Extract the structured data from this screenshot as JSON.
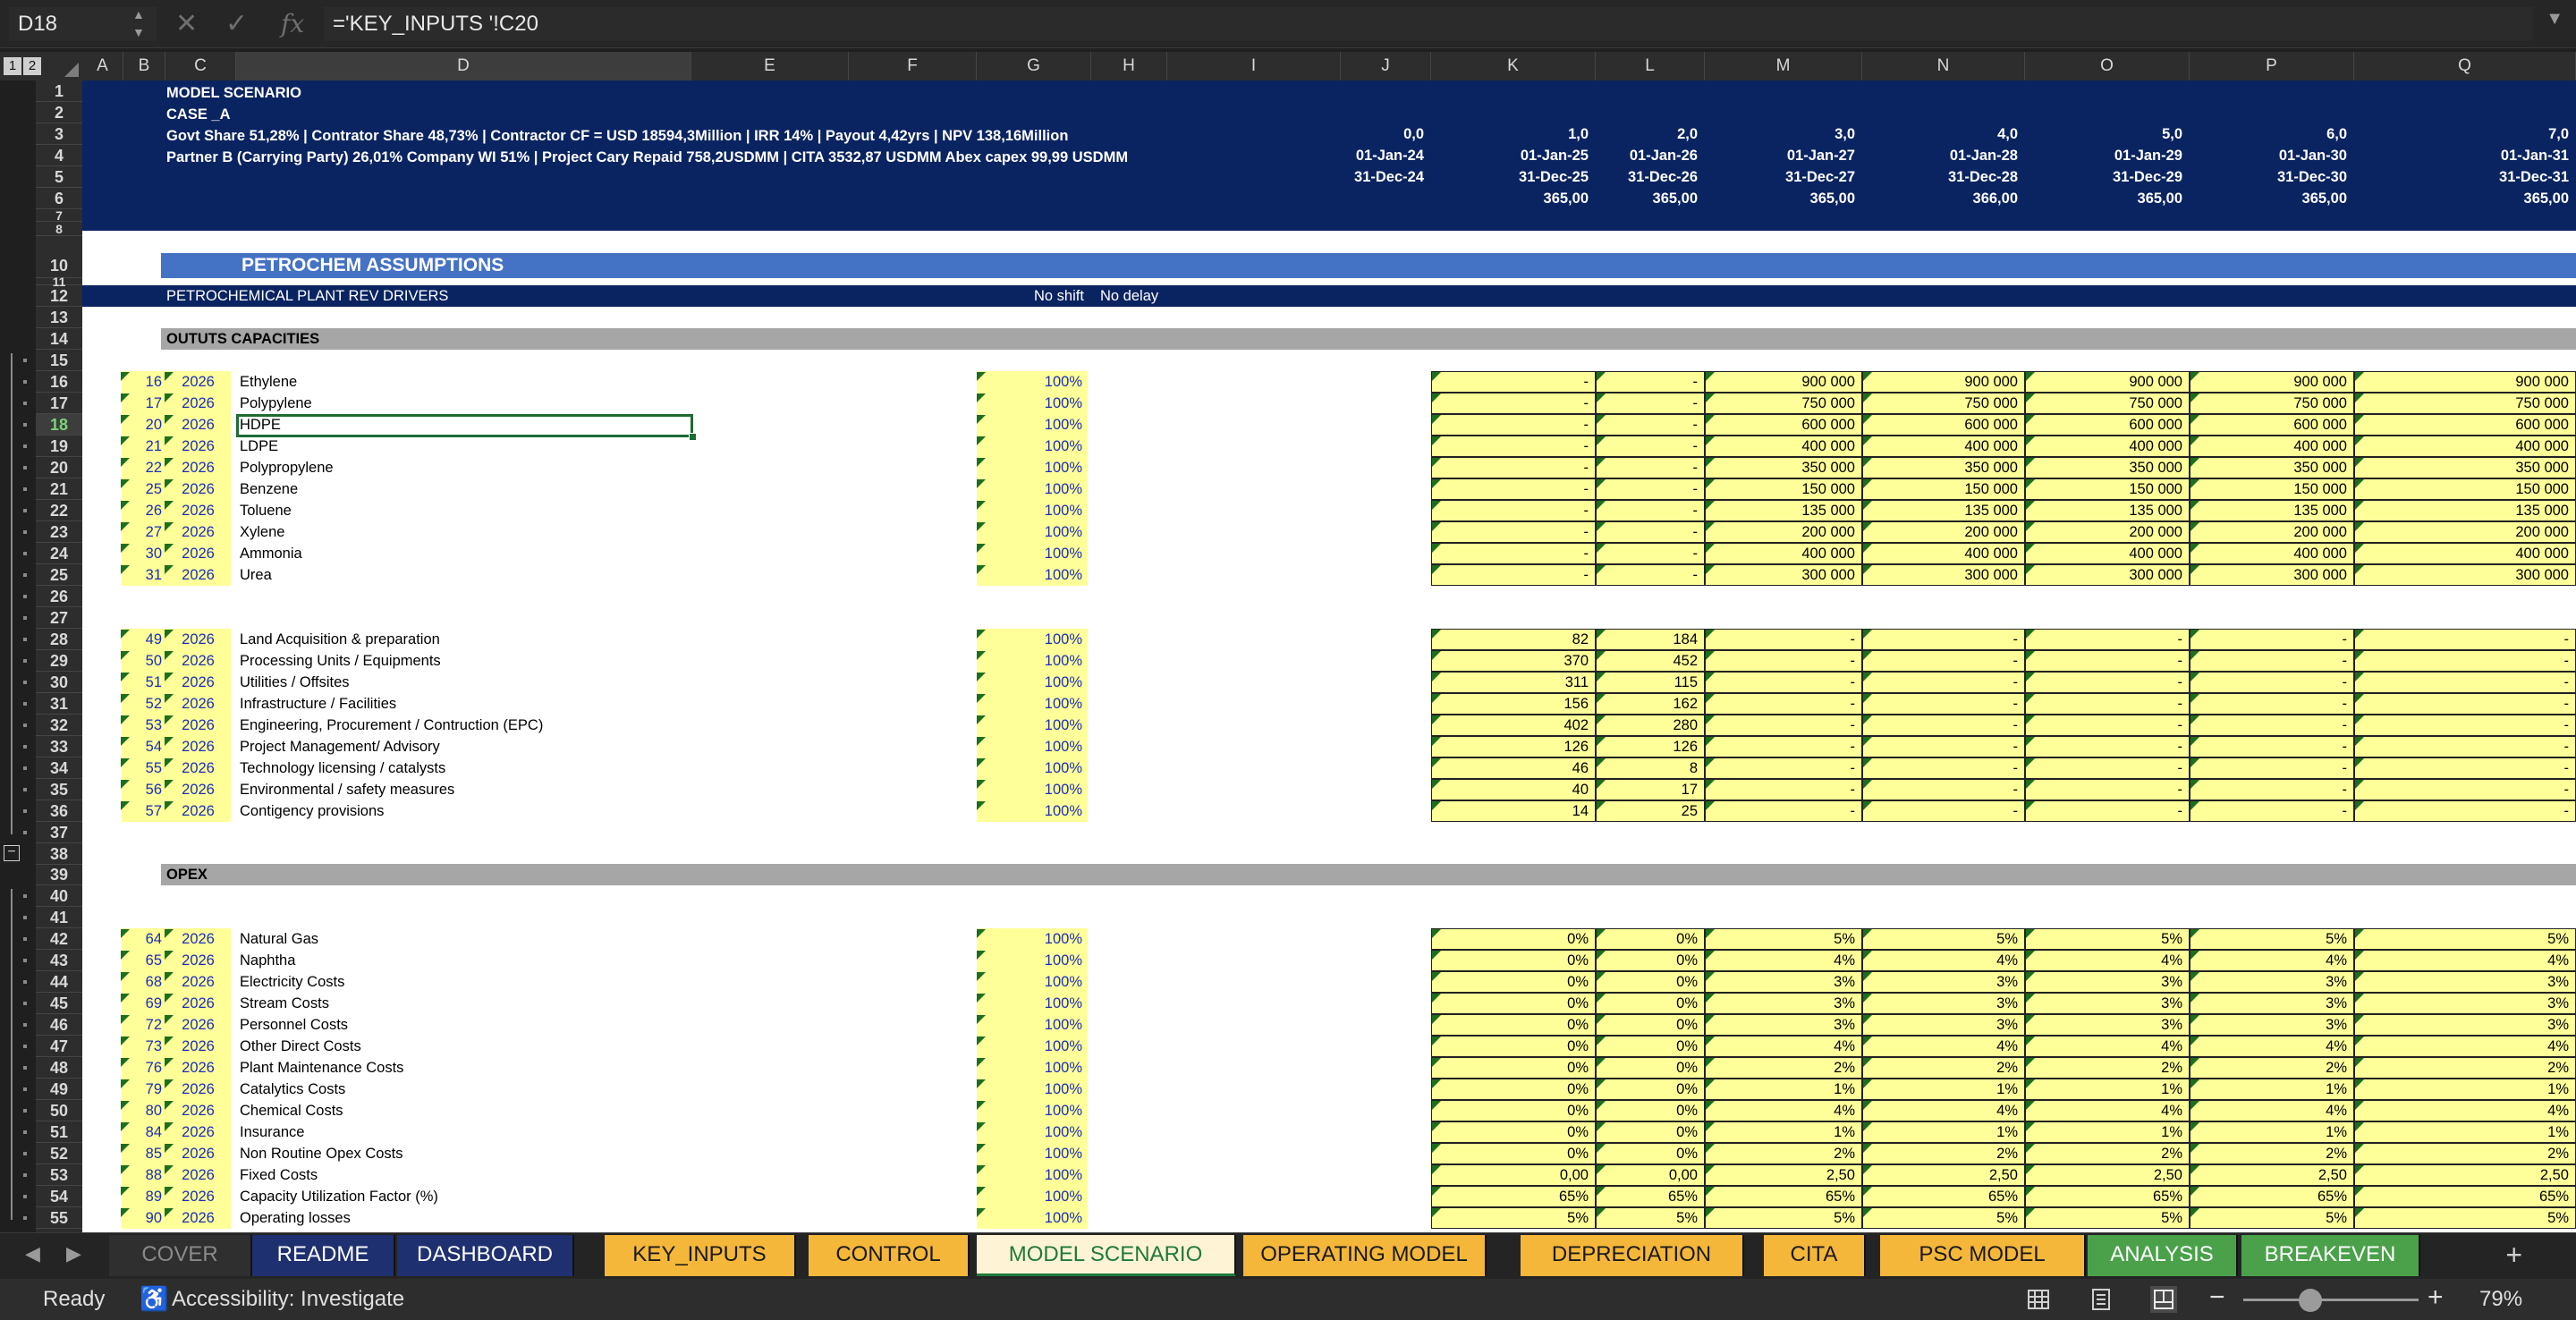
{
  "formula_bar": {
    "name_box": "D18",
    "formula": "='KEY_INPUTS '!C20",
    "fx": "fx"
  },
  "outline_levels": [
    "1",
    "2"
  ],
  "columns": [
    "A",
    "B",
    "C",
    "D",
    "E",
    "F",
    "G",
    "H",
    "I",
    "J",
    "K",
    "L",
    "M",
    "N",
    "O",
    "P",
    "Q"
  ],
  "selected_column": "D",
  "selected_row": "18",
  "header": {
    "model_scenario": "MODEL SCENARIO",
    "case": "CASE _A",
    "line3": "Govt Share 51,28% | Contrator Share 48,73% |  Contractor CF = USD 18594,3Million | IRR 14% | Payout 4,42yrs | NPV 138,16Million",
    "line4": "Partner B (Carrying Party) 26,01% Company WI 51% |  Project Cary Repaid  758,2USDMM  |  CITA 3532,87  USDMM Abex capex 99,99  USDMM",
    "periods": [
      {
        "col": "J",
        "year": "0,0",
        "start": "01-Jan-24",
        "end": "31-Dec-24",
        "days": ""
      },
      {
        "col": "K",
        "year": "1,0",
        "start": "01-Jan-25",
        "end": "31-Dec-25",
        "days": "365,00"
      },
      {
        "col": "L",
        "year": "2,0",
        "start": "01-Jan-26",
        "end": "31-Dec-26",
        "days": "365,00"
      },
      {
        "col": "M",
        "year": "3,0",
        "start": "01-Jan-27",
        "end": "31-Dec-27",
        "days": "365,00"
      },
      {
        "col": "N",
        "year": "4,0",
        "start": "01-Jan-28",
        "end": "31-Dec-28",
        "days": "366,00"
      },
      {
        "col": "O",
        "year": "5,0",
        "start": "01-Jan-29",
        "end": "31-Dec-29",
        "days": "365,00"
      },
      {
        "col": "P",
        "year": "6,0",
        "start": "01-Jan-30",
        "end": "31-Dec-30",
        "days": "365,00"
      },
      {
        "col": "Q",
        "year": "7,0",
        "start": "01-Jan-31",
        "end": "31-Dec-31",
        "days": "365,00"
      }
    ]
  },
  "row_numbers": [
    "1",
    "2",
    "3",
    "4",
    "5",
    "6",
    "7",
    "8",
    "10",
    "11",
    "12",
    "13",
    "14",
    "15",
    "16",
    "17",
    "18",
    "19",
    "20",
    "21",
    "22",
    "23",
    "24",
    "25",
    "26",
    "27",
    "28",
    "29",
    "30",
    "31",
    "32",
    "33",
    "34",
    "35",
    "36",
    "37",
    "38",
    "39",
    "40",
    "41",
    "42",
    "43",
    "44",
    "45",
    "46",
    "47",
    "48",
    "49",
    "50",
    "51",
    "52",
    "53",
    "54",
    "55"
  ],
  "petrochem_title": "PETROCHEM ASSUMPTIONS",
  "rev_drivers": {
    "label": "PETROCHEMICAL PLANT REV DRIVERS",
    "shift": "No shift",
    "delay": "No delay"
  },
  "sections": {
    "outputs": "OUTUTS CAPACITIES",
    "opex": "OPEX"
  },
  "output_rows": [
    {
      "row": "16",
      "ref": "16",
      "year": "2026",
      "name": "Ethylene",
      "pct": "100%",
      "vals": [
        "-",
        "-",
        "900 000",
        "900 000",
        "900 000",
        "900 000",
        "900 000"
      ]
    },
    {
      "row": "17",
      "ref": "17",
      "year": "2026",
      "name": "Polypylene",
      "pct": "100%",
      "vals": [
        "-",
        "-",
        "750 000",
        "750 000",
        "750 000",
        "750 000",
        "750 000"
      ]
    },
    {
      "row": "18",
      "ref": "20",
      "year": "2026",
      "name": "HDPE",
      "pct": "100%",
      "vals": [
        "-",
        "-",
        "600 000",
        "600 000",
        "600 000",
        "600 000",
        "600 000"
      ]
    },
    {
      "row": "19",
      "ref": "21",
      "year": "2026",
      "name": "LDPE",
      "pct": "100%",
      "vals": [
        "-",
        "-",
        "400 000",
        "400 000",
        "400 000",
        "400 000",
        "400 000"
      ]
    },
    {
      "row": "20",
      "ref": "22",
      "year": "2026",
      "name": "Polypropylene",
      "pct": "100%",
      "vals": [
        "-",
        "-",
        "350 000",
        "350 000",
        "350 000",
        "350 000",
        "350 000"
      ]
    },
    {
      "row": "21",
      "ref": "25",
      "year": "2026",
      "name": "Benzene",
      "pct": "100%",
      "vals": [
        "-",
        "-",
        "150 000",
        "150 000",
        "150 000",
        "150 000",
        "150 000"
      ]
    },
    {
      "row": "22",
      "ref": "26",
      "year": "2026",
      "name": "Toluene",
      "pct": "100%",
      "vals": [
        "-",
        "-",
        "135 000",
        "135 000",
        "135 000",
        "135 000",
        "135 000"
      ]
    },
    {
      "row": "23",
      "ref": "27",
      "year": "2026",
      "name": "Xylene",
      "pct": "100%",
      "vals": [
        "-",
        "-",
        "200 000",
        "200 000",
        "200 000",
        "200 000",
        "200 000"
      ]
    },
    {
      "row": "24",
      "ref": "30",
      "year": "2026",
      "name": "Ammonia",
      "pct": "100%",
      "vals": [
        "-",
        "-",
        "400 000",
        "400 000",
        "400 000",
        "400 000",
        "400 000"
      ]
    },
    {
      "row": "25",
      "ref": "31",
      "year": "2026",
      "name": "Urea",
      "pct": "100%",
      "vals": [
        "-",
        "-",
        "300 000",
        "300 000",
        "300 000",
        "300 000",
        "300 000"
      ]
    }
  ],
  "capex_rows": [
    {
      "row": "28",
      "ref": "49",
      "year": "2026",
      "name": "Land Acquisition & preparation",
      "pct": "100%",
      "vals": [
        "82",
        "184",
        "-",
        "-",
        "-",
        "-",
        "-"
      ]
    },
    {
      "row": "29",
      "ref": "50",
      "year": "2026",
      "name": "Processing Units /  Equipments",
      "pct": "100%",
      "vals": [
        "370",
        "452",
        "-",
        "-",
        "-",
        "-",
        "-"
      ]
    },
    {
      "row": "30",
      "ref": "51",
      "year": "2026",
      "name": "Utilities  /  Offsites",
      "pct": "100%",
      "vals": [
        "311",
        "115",
        "-",
        "-",
        "-",
        "-",
        "-"
      ]
    },
    {
      "row": "31",
      "ref": "52",
      "year": "2026",
      "name": "Infrastructure /  Facilities",
      "pct": "100%",
      "vals": [
        "156",
        "162",
        "-",
        "-",
        "-",
        "-",
        "-"
      ]
    },
    {
      "row": "32",
      "ref": "53",
      "year": "2026",
      "name": "Engineering, Procurement / Contruction (EPC)",
      "pct": "100%",
      "vals": [
        "402",
        "280",
        "-",
        "-",
        "-",
        "-",
        "-"
      ]
    },
    {
      "row": "33",
      "ref": "54",
      "year": "2026",
      "name": "Project Management/ Advisory",
      "pct": "100%",
      "vals": [
        "126",
        "126",
        "-",
        "-",
        "-",
        "-",
        "-"
      ]
    },
    {
      "row": "34",
      "ref": "55",
      "year": "2026",
      "name": "Technology licensing  / catalysts",
      "pct": "100%",
      "vals": [
        "46",
        "8",
        "-",
        "-",
        "-",
        "-",
        "-"
      ]
    },
    {
      "row": "35",
      "ref": "56",
      "year": "2026",
      "name": "Environmental / safety measures",
      "pct": "100%",
      "vals": [
        "40",
        "17",
        "-",
        "-",
        "-",
        "-",
        "-"
      ]
    },
    {
      "row": "36",
      "ref": "57",
      "year": "2026",
      "name": "Contigency provisions",
      "pct": "100%",
      "vals": [
        "14",
        "25",
        "-",
        "-",
        "-",
        "-",
        "-"
      ]
    }
  ],
  "opex_rows": [
    {
      "row": "42",
      "ref": "64",
      "year": "2026",
      "name": "Natural Gas",
      "pct": "100%",
      "vals": [
        "0%",
        "0%",
        "5%",
        "5%",
        "5%",
        "5%",
        "5%"
      ]
    },
    {
      "row": "43",
      "ref": "65",
      "year": "2026",
      "name": "Naphtha",
      "pct": "100%",
      "vals": [
        "0%",
        "0%",
        "4%",
        "4%",
        "4%",
        "4%",
        "4%"
      ]
    },
    {
      "row": "44",
      "ref": "68",
      "year": "2026",
      "name": "Electricity Costs",
      "pct": "100%",
      "vals": [
        "0%",
        "0%",
        "3%",
        "3%",
        "3%",
        "3%",
        "3%"
      ]
    },
    {
      "row": "45",
      "ref": "69",
      "year": "2026",
      "name": "Stream Costs",
      "pct": "100%",
      "vals": [
        "0%",
        "0%",
        "3%",
        "3%",
        "3%",
        "3%",
        "3%"
      ]
    },
    {
      "row": "46",
      "ref": "72",
      "year": "2026",
      "name": "Personnel Costs",
      "pct": "100%",
      "vals": [
        "0%",
        "0%",
        "3%",
        "3%",
        "3%",
        "3%",
        "3%"
      ]
    },
    {
      "row": "47",
      "ref": "73",
      "year": "2026",
      "name": "Other Direct Costs",
      "pct": "100%",
      "vals": [
        "0%",
        "0%",
        "4%",
        "4%",
        "4%",
        "4%",
        "4%"
      ]
    },
    {
      "row": "48",
      "ref": "76",
      "year": "2026",
      "name": "Plant Maintenance Costs",
      "pct": "100%",
      "vals": [
        "0%",
        "0%",
        "2%",
        "2%",
        "2%",
        "2%",
        "2%"
      ]
    },
    {
      "row": "49",
      "ref": "79",
      "year": "2026",
      "name": "Catalytics Costs",
      "pct": "100%",
      "vals": [
        "0%",
        "0%",
        "1%",
        "1%",
        "1%",
        "1%",
        "1%"
      ]
    },
    {
      "row": "50",
      "ref": "80",
      "year": "2026",
      "name": "Chemical Costs",
      "pct": "100%",
      "vals": [
        "0%",
        "0%",
        "4%",
        "4%",
        "4%",
        "4%",
        "4%"
      ]
    },
    {
      "row": "51",
      "ref": "84",
      "year": "2026",
      "name": "Insurance",
      "pct": "100%",
      "vals": [
        "0%",
        "0%",
        "1%",
        "1%",
        "1%",
        "1%",
        "1%"
      ]
    },
    {
      "row": "52",
      "ref": "85",
      "year": "2026",
      "name": "Non Routine Opex Costs",
      "pct": "100%",
      "vals": [
        "0%",
        "0%",
        "2%",
        "2%",
        "2%",
        "2%",
        "2%"
      ]
    },
    {
      "row": "53",
      "ref": "88",
      "year": "2026",
      "name": "Fixed Costs",
      "pct": "100%",
      "vals": [
        "0,00",
        "0,00",
        "2,50",
        "2,50",
        "2,50",
        "2,50",
        "2,50"
      ]
    },
    {
      "row": "54",
      "ref": "89",
      "year": "2026",
      "name": "Capacity Utilization Factor (%)",
      "pct": "100%",
      "vals": [
        "65%",
        "65%",
        "65%",
        "65%",
        "65%",
        "65%",
        "65%"
      ]
    },
    {
      "row": "55",
      "ref": "90",
      "year": "2026",
      "name": "Operating losses",
      "pct": "100%",
      "vals": [
        "5%",
        "5%",
        "5%",
        "5%",
        "5%",
        "5%",
        "5%"
      ]
    }
  ],
  "tabs": [
    {
      "label": "COVER",
      "bg": "#2f2f2f",
      "fg": "#8a8a8a",
      "active": false
    },
    {
      "label": "README",
      "bg": "#1f3070",
      "fg": "#ffffff",
      "active": false
    },
    {
      "label": "DASHBOARD",
      "bg": "#1f3070",
      "fg": "#ffffff",
      "active": false
    },
    {
      "label": "KEY_INPUTS",
      "bg": "#f4b73a",
      "fg": "#1a1a1a",
      "active": false
    },
    {
      "label": "CONTROL",
      "bg": "#f4b73a",
      "fg": "#1a1a1a",
      "active": false
    },
    {
      "label": "MODEL SCENARIO",
      "bg": "#fff3d6",
      "fg": "#1e7a3a",
      "active": true
    },
    {
      "label": "OPERATING MODEL",
      "bg": "#f4b73a",
      "fg": "#1a1a1a",
      "active": false
    },
    {
      "label": "DEPRECIATION",
      "bg": "#f4b73a",
      "fg": "#1a1a1a",
      "active": false
    },
    {
      "label": "CITA",
      "bg": "#f4b73a",
      "fg": "#1a1a1a",
      "active": false
    },
    {
      "label": "PSC MODEL",
      "bg": "#f4b73a",
      "fg": "#1a1a1a",
      "active": false
    },
    {
      "label": "ANALYSIS",
      "bg": "#4aa14a",
      "fg": "#ffffff",
      "active": false
    },
    {
      "label": "BREAKEVEN",
      "bg": "#4aa14a",
      "fg": "#ffffff",
      "active": false
    }
  ],
  "status": {
    "ready": "Ready",
    "accessibility": "Accessibility: Investigate",
    "zoom": "79%"
  },
  "colors": {
    "header_navy": "#0a2461",
    "petrochem_blue": "#4472c4",
    "section_grey": "#a6a6a6",
    "input_yellow": "#ffff99",
    "input_blue_text": "#1a2eb8"
  }
}
